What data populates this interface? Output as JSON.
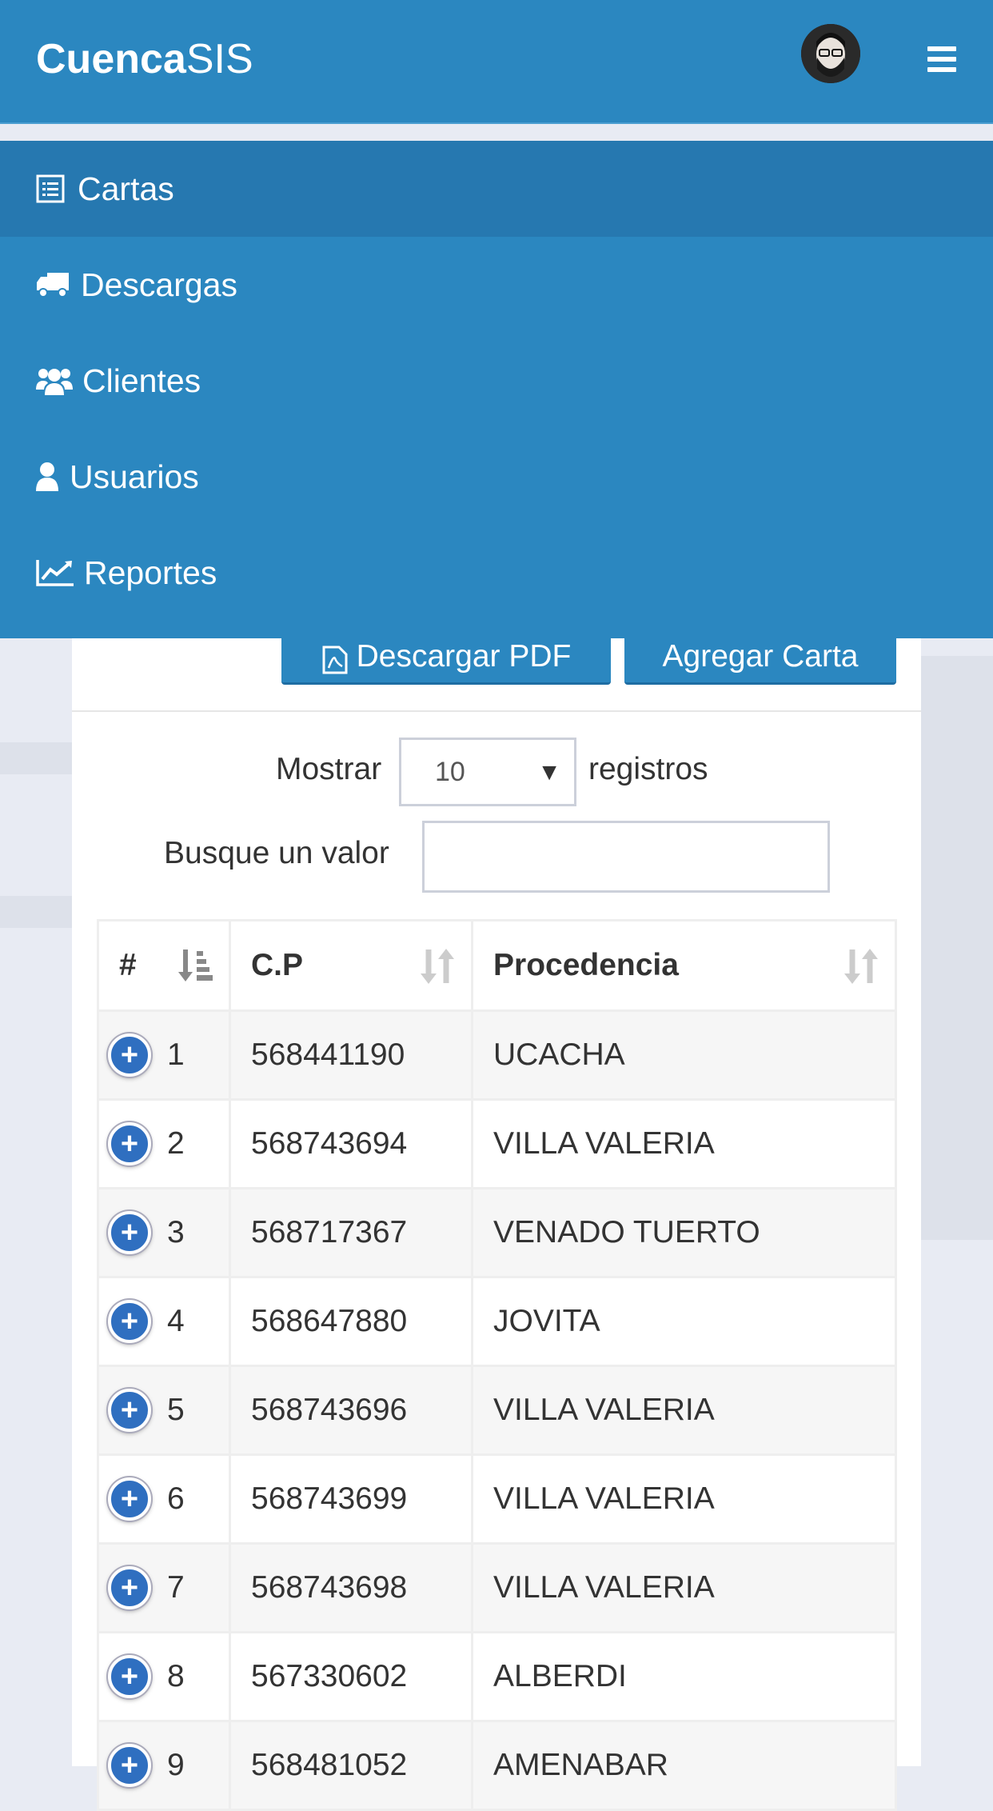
{
  "header": {
    "brand_bold": "Cuenca",
    "brand_light": "SIS"
  },
  "menu": {
    "items": [
      {
        "label": "Cartas",
        "icon": "list-alt-icon"
      },
      {
        "label": "Descargas",
        "icon": "truck-icon"
      },
      {
        "label": "Clientes",
        "icon": "users-icon"
      },
      {
        "label": "Usuarios",
        "icon": "user-icon"
      },
      {
        "label": "Reportes",
        "icon": "line-chart-icon"
      }
    ]
  },
  "toolbar": {
    "pdf_label": "Descargar PDF",
    "add_label": "Agregar Carta"
  },
  "filters": {
    "show_label": "Mostrar",
    "page_size": "10",
    "records_label": "registros",
    "search_label": "Busque un valor",
    "search_value": ""
  },
  "table": {
    "columns": [
      "#",
      "C.P",
      "Procedencia"
    ],
    "rows": [
      {
        "n": "1",
        "cp": "568441190",
        "origin": "UCACHA"
      },
      {
        "n": "2",
        "cp": "568743694",
        "origin": "VILLA VALERIA"
      },
      {
        "n": "3",
        "cp": "568717367",
        "origin": "VENADO TUERTO"
      },
      {
        "n": "4",
        "cp": "568647880",
        "origin": "JOVITA"
      },
      {
        "n": "5",
        "cp": "568743696",
        "origin": "VILLA VALERIA"
      },
      {
        "n": "6",
        "cp": "568743699",
        "origin": "VILLA VALERIA"
      },
      {
        "n": "7",
        "cp": "568743698",
        "origin": "VILLA VALERIA"
      },
      {
        "n": "8",
        "cp": "567330602",
        "origin": "ALBERDI"
      },
      {
        "n": "9",
        "cp": "568481052",
        "origin": "AMENABAR"
      }
    ]
  },
  "colors": {
    "primary": "#2b87c0",
    "active_menu": "#2678b0",
    "expand_button": "#2f6fc0"
  }
}
